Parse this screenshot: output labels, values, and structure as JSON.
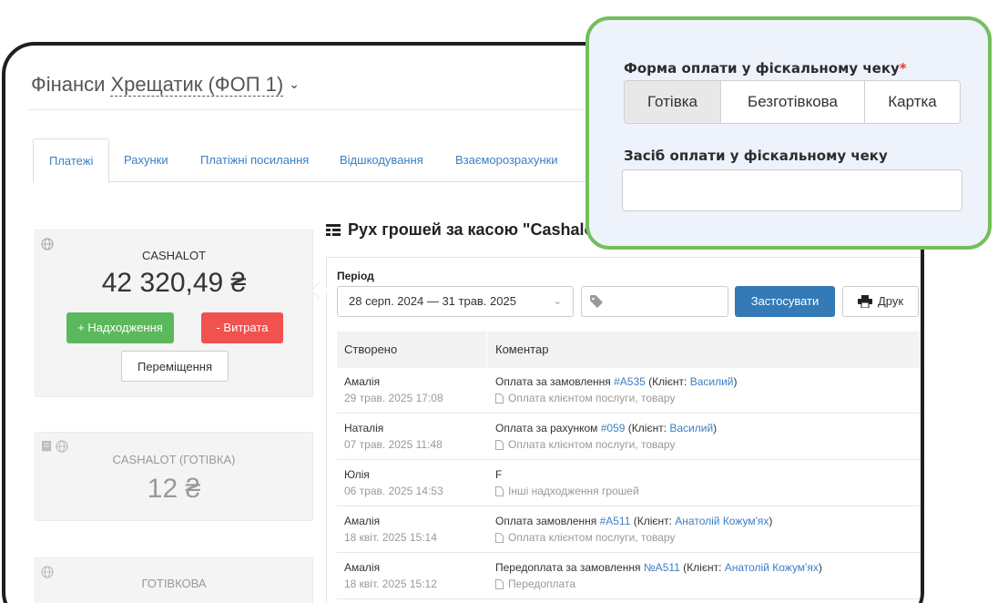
{
  "header": {
    "section": "Фінанси",
    "store": "Хрещатик (ФОП 1)",
    "chevron_icon": "chevron-down-icon"
  },
  "tabs": [
    {
      "label": "Платежі",
      "active": true
    },
    {
      "label": "Рахунки",
      "active": false
    },
    {
      "label": "Платіжні посилання",
      "active": false
    },
    {
      "label": "Відшкодування",
      "active": false
    },
    {
      "label": "Взаєморозрахунки",
      "active": false
    }
  ],
  "accounts": [
    {
      "name": "CASHALOT",
      "amount": "42 320,49 ₴",
      "icons": [
        "globe-icon"
      ]
    },
    {
      "name": "CASHALOT (ГОТІВКА)",
      "amount": "12 ₴",
      "icons": [
        "receipt-icon",
        "globe-icon"
      ]
    },
    {
      "name": "ГОТІВКОВА",
      "amount": "",
      "icons": [
        "globe-icon"
      ]
    }
  ],
  "actions": {
    "income": "+ Надходження",
    "expense": "- Витрата",
    "transfer": "Переміщення"
  },
  "panel": {
    "title": "Рух грошей за касою \"Cashalo",
    "period_label": "Період",
    "period_value": "28 серп. 2024 — 31 трав. 2025",
    "apply": "Застосувати",
    "print": "Друк"
  },
  "table": {
    "columns": [
      "Створено",
      "Коментар"
    ],
    "rows": [
      {
        "who": "Амалія",
        "when": "29 трав. 2025 17:08",
        "prefix": "Оплата за замовлення ",
        "ref": "#A535",
        "client_prefix": " (Клієнт: ",
        "client": "Василий",
        "suffix": ")",
        "sub": "Оплата клієнтом послуги, товару"
      },
      {
        "who": "Наталія",
        "when": "07 трав. 2025 11:48",
        "prefix": "Оплата за рахунком ",
        "ref": "#059",
        "client_prefix": " (Клієнт: ",
        "client": "Василий",
        "suffix": ")",
        "sub": "Оплата клієнтом послуги, товару"
      },
      {
        "who": "Юлія",
        "when": "06 трав. 2025 14:53",
        "prefix": "F",
        "ref": "",
        "client_prefix": "",
        "client": "",
        "suffix": "",
        "sub": "Інші надходження грошей"
      },
      {
        "who": "Амалія",
        "when": "18 квіт. 2025 15:14",
        "prefix": "Оплата замовлення ",
        "ref": "#A511",
        "client_prefix": " (Клієнт: ",
        "client": "Анатолій Кожум'ях",
        "suffix": ")",
        "sub": "Оплата клієнтом послуги, товару"
      },
      {
        "who": "Амалія",
        "when": "18 квіт. 2025 15:12",
        "prefix": "Передоплата за замовлення ",
        "ref": "№A511",
        "client_prefix": " (Клієнт: ",
        "client": "Анатолій Кожум'ях",
        "suffix": ")",
        "sub": "Передоплата"
      }
    ]
  },
  "callout": {
    "form_label": "Форма оплати у фіскальному чеку",
    "required_mark": "*",
    "options": [
      "Готівка",
      "Безготівкова",
      "Картка"
    ],
    "selected": "Готівка",
    "means_label": "Засіб оплати у фіскальному чеку",
    "means_value": ""
  },
  "colors": {
    "callout_border": "#72bf5b",
    "link": "#3b7fc4",
    "green": "#5cb85c",
    "red": "#f0524f",
    "blue": "#337ab7"
  }
}
